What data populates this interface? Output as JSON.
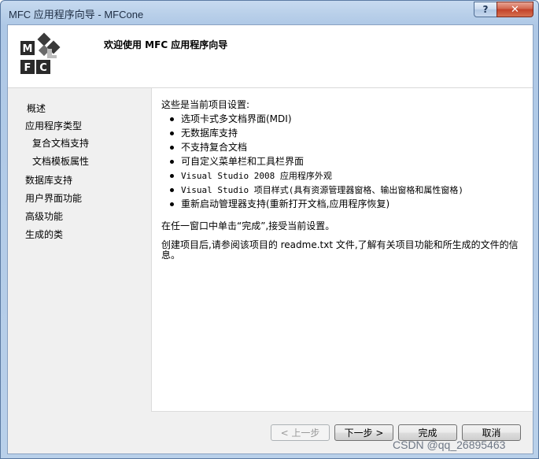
{
  "window": {
    "title": "MFC 应用程序向导 - MFCone",
    "help_label": "?",
    "close_label": "✕"
  },
  "header": {
    "title": "欢迎使用 MFC 应用程序向导",
    "logo_letters": [
      "M",
      "F",
      "C"
    ]
  },
  "nav": {
    "items": [
      {
        "label": "概述",
        "current": true
      },
      {
        "label": "应用程序类型"
      },
      {
        "label": "复合文档支持",
        "sub": true
      },
      {
        "label": "文档模板属性",
        "sub": true
      },
      {
        "label": "数据库支持"
      },
      {
        "label": "用户界面功能"
      },
      {
        "label": "高级功能"
      },
      {
        "label": "生成的类"
      }
    ]
  },
  "content": {
    "intro": "这些是当前项目设置:",
    "settings": [
      "选项卡式多文档界面(MDI)",
      "无数据库支持",
      "不支持复合文档",
      "可自定义菜单栏和工具栏界面",
      "Visual Studio 2008 应用程序外观",
      "Visual Studio 项目样式(具有资源管理器窗格、输出窗格和属性窗格)",
      "重新启动管理器支持(重新打开文档,应用程序恢复)"
    ],
    "finish_hint": "在任一窗口中单击“完成”,接受当前设置。",
    "after_create": "创建项目后,请参阅该项目的 readme.txt 文件,了解有关项目功能和所生成的文件的信息。"
  },
  "buttons": {
    "prev": "< 上一步",
    "next": "下一步 >",
    "finish": "完成",
    "cancel": "取消"
  },
  "watermark": "CSDN @qq_26895463"
}
